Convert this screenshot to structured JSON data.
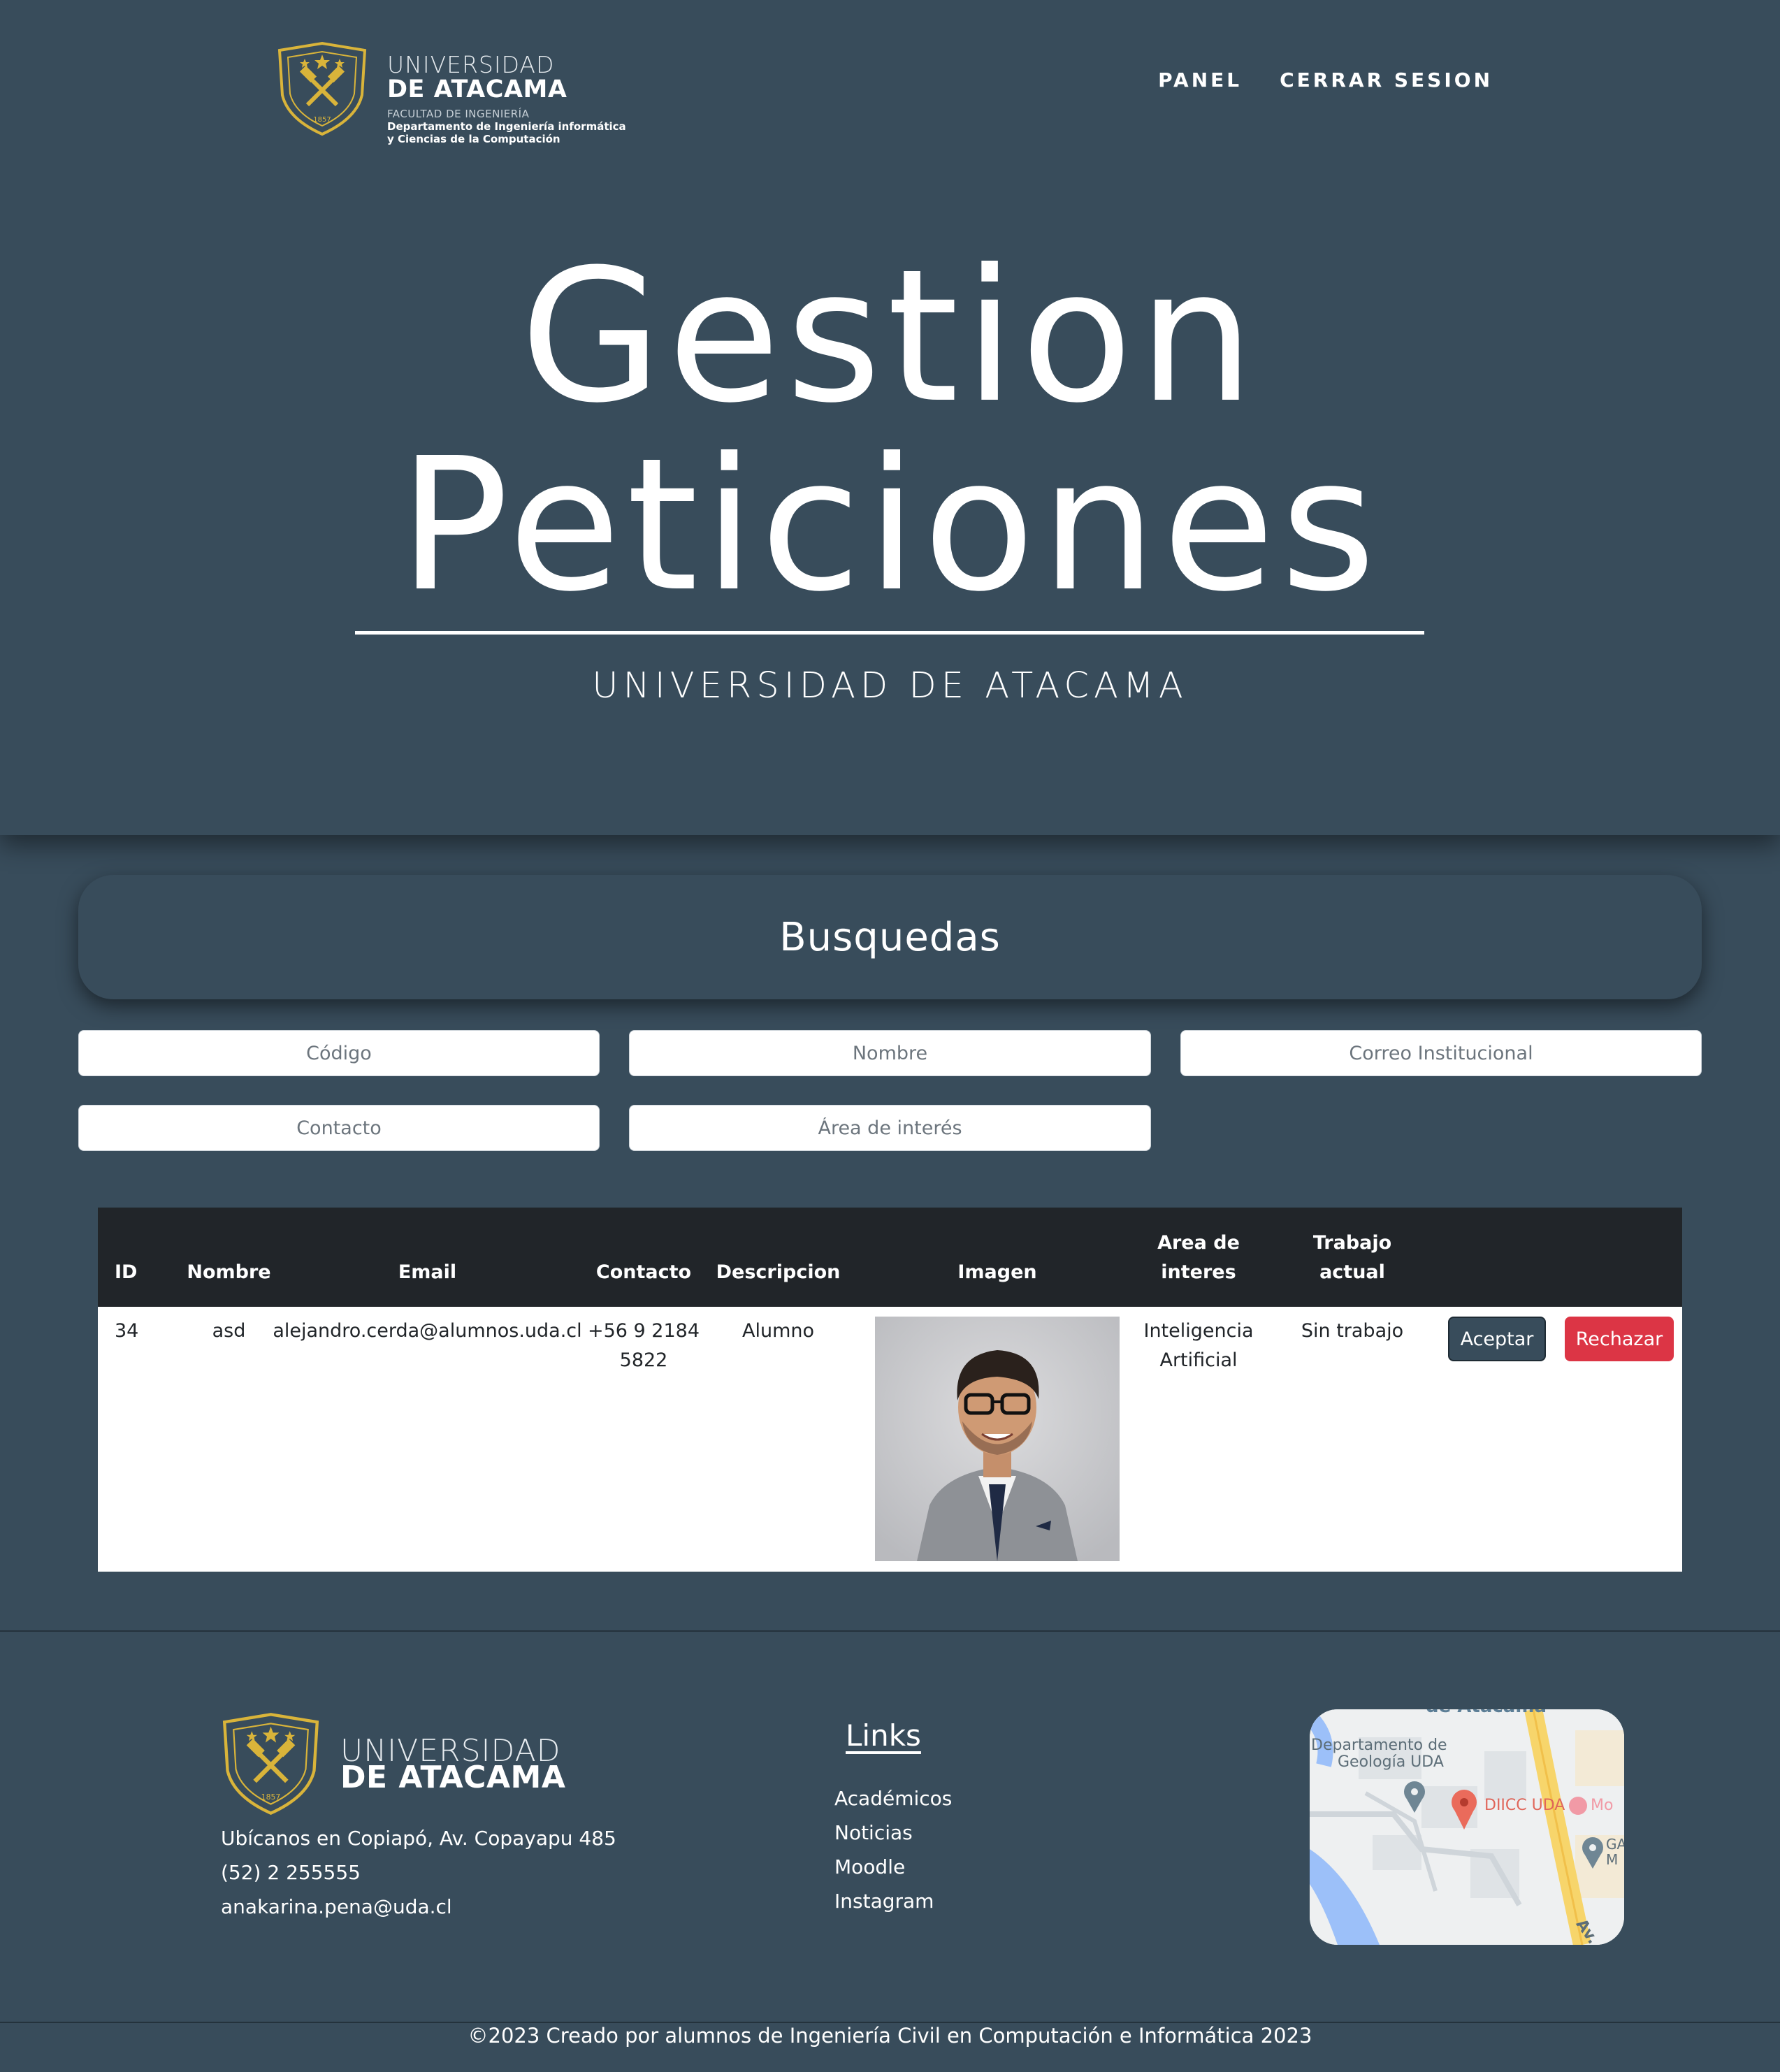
{
  "header": {
    "logo": {
      "line1": "UNIVERSIDAD",
      "line2": "DE ATACAMA",
      "faculty": "FACULTAD DE INGENIERÍA",
      "department_line1": "Departamento de Ingeniería informática",
      "department_line2": "y Ciencias de la Computación",
      "crest_year": "1857"
    },
    "nav": {
      "panel": "PANEL",
      "logout": "CERRAR SESION"
    }
  },
  "hero": {
    "title_line1": "Gestion",
    "title_line2": "Peticiones",
    "subtitle": "UNIVERSIDAD DE ATACAMA"
  },
  "search": {
    "heading": "Busquedas",
    "fields": {
      "codigo": "Código",
      "nombre": "Nombre",
      "correo": "Correo Institucional",
      "contacto": "Contacto",
      "area": "Área de interés"
    }
  },
  "table": {
    "headers": {
      "id": "ID",
      "nombre": "Nombre",
      "email": "Email",
      "contacto": "Contacto",
      "descripcion": "Descripcion",
      "imagen": "Imagen",
      "area_line1": "Area de",
      "area_line2": "interes",
      "trabajo_line1": "Trabajo",
      "trabajo_line2": "actual"
    },
    "rows": [
      {
        "id": "34",
        "nombre": "asd",
        "email": "alejandro.cerda@alumnos.uda.cl",
        "contacto_line1": "+56 9 2184",
        "contacto_line2": "5822",
        "descripcion": "Alumno",
        "area_line1": "Inteligencia",
        "area_line2": "Artificial",
        "trabajo": "Sin trabajo",
        "accept_label": "Aceptar",
        "reject_label": "Rechazar"
      }
    ]
  },
  "footer": {
    "logo_line1": "UNIVERSIDAD",
    "logo_line2": "DE ATACAMA",
    "address": "Ubícanos en Copiapó, Av. Copayapu 485",
    "phone": "(52) 2 255555",
    "email": "anakarina.pena@uda.cl",
    "links_title": "Links",
    "links": [
      "Académicos",
      "Noticias",
      "Moodle",
      "Instagram"
    ],
    "map": {
      "label_top": "de Atacama",
      "label_geologia_1": "Departamento de",
      "label_geologia_2": "Geología UDA",
      "label_diicc": "DIICC UDA",
      "label_mo": "Mo",
      "label_ga": "GA",
      "label_m": "M",
      "label_av": "Av."
    },
    "copyright": "©2023 Creado por alumnos de Ingeniería Civil en Computación e Informática 2023"
  },
  "colors": {
    "background": "#384c5b",
    "table_header": "#212529",
    "reject": "#dc3545",
    "accent_gold": "#d9b43a"
  }
}
